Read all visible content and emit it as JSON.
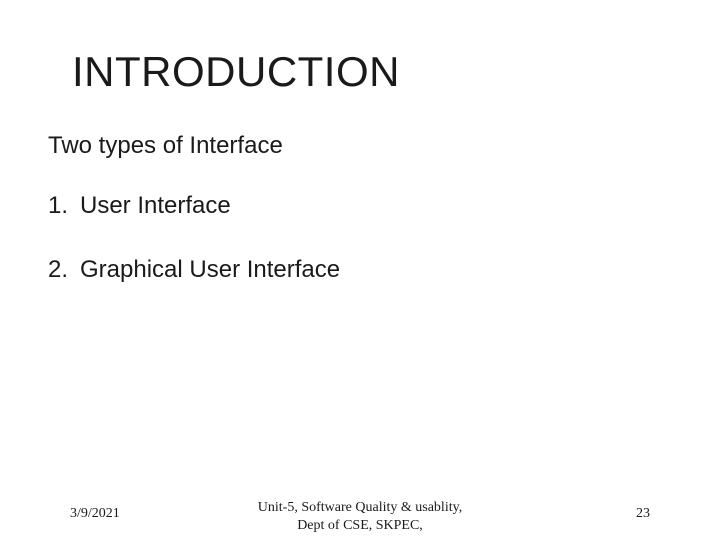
{
  "slide": {
    "title": "INTRODUCTION",
    "subtitle": "Two types of Interface",
    "items": [
      {
        "num": "1.",
        "text": "User Interface"
      },
      {
        "num": "2.",
        "text": "Graphical User Interface"
      }
    ]
  },
  "footer": {
    "date": "3/9/2021",
    "center": "Unit-5, Software Quality & usablity,\nDept of CSE, SKPEC,",
    "page": "23"
  }
}
